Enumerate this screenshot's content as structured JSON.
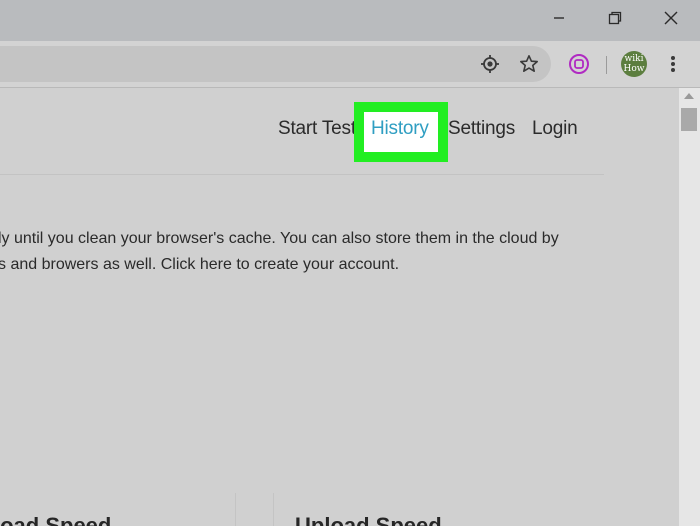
{
  "browser": {
    "window_controls": [
      "minimize",
      "restore",
      "close"
    ],
    "toolbar_icons": [
      "location-icon",
      "star-icon",
      "extension-icon",
      "menu-icon"
    ],
    "avatar": {
      "line1": "wiki",
      "line2": "How"
    }
  },
  "site": {
    "nav": {
      "start_test": "Start Test",
      "history": "History",
      "settings": "Settings",
      "login": "Login"
    },
    "content": {
      "line1": "ly until you clean your browser's cache. You can also store them in the cloud by",
      "line2": "s and browers as well. Click here to create your account."
    },
    "speed": {
      "left_label": "load Speed",
      "right_label": "Upload Speed"
    }
  },
  "colors": {
    "highlight": "#22ee22",
    "link_active": "#2f9ec2"
  }
}
